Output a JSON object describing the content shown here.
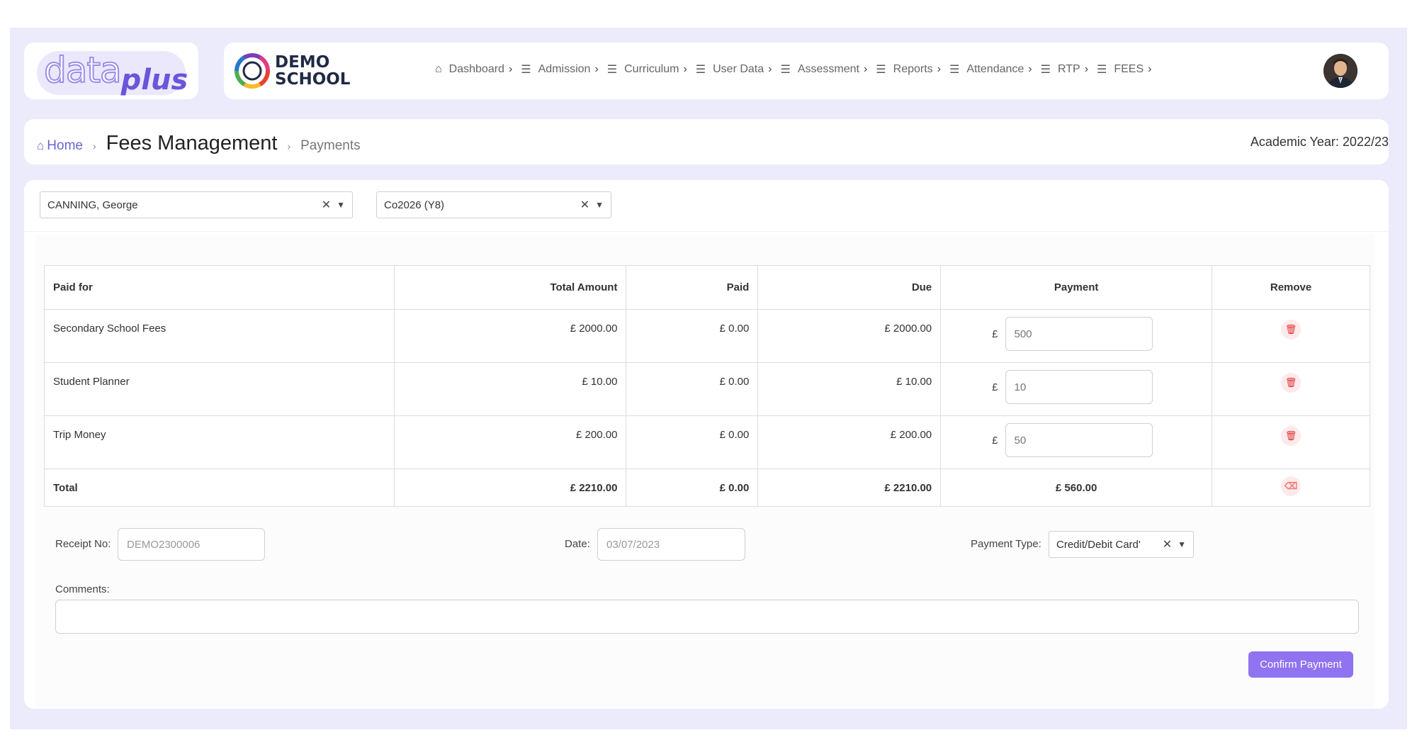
{
  "app": {
    "logo": {
      "part1": "data",
      "part2": "plus"
    },
    "school": {
      "line1": "DEMO",
      "line2": "SCHOOL"
    }
  },
  "nav": {
    "items": [
      {
        "label": "Dashboard",
        "icon": "home-icon"
      },
      {
        "label": "Admission",
        "icon": "menu-icon"
      },
      {
        "label": "Curriculum",
        "icon": "menu-icon"
      },
      {
        "label": "User Data",
        "icon": "menu-icon"
      },
      {
        "label": "Assessment",
        "icon": "menu-icon"
      },
      {
        "label": "Reports",
        "icon": "menu-icon"
      },
      {
        "label": "Attendance",
        "icon": "menu-icon"
      },
      {
        "label": "RTP",
        "icon": "menu-icon"
      },
      {
        "label": "FEES",
        "icon": "menu-icon"
      }
    ]
  },
  "breadcrumb": {
    "home": "Home",
    "title": "Fees Management",
    "sub": "Payments"
  },
  "academic_year": "Academic Year: 2022/23",
  "filters": {
    "student": "CANNING, George",
    "class": "Co2026 (Y8)"
  },
  "table": {
    "headers": {
      "paid_for": "Paid for",
      "total": "Total Amount",
      "paid": "Paid",
      "due": "Due",
      "payment": "Payment",
      "remove": "Remove"
    },
    "currency": "£",
    "rows": [
      {
        "name": "Secondary School Fees",
        "total": "£ 2000.00",
        "paid": "£ 0.00",
        "due": "£ 2000.00",
        "payment": "500"
      },
      {
        "name": "Student Planner",
        "total": "£ 10.00",
        "paid": "£ 0.00",
        "due": "£ 10.00",
        "payment": "10"
      },
      {
        "name": "Trip Money",
        "total": "£ 200.00",
        "paid": "£ 0.00",
        "due": "£ 200.00",
        "payment": "50"
      }
    ],
    "total_row": {
      "label": "Total",
      "total": "£ 2210.00",
      "paid": "£ 0.00",
      "due": "£ 2210.00",
      "payment": "£ 560.00"
    }
  },
  "form": {
    "receipt_label": "Receipt No:",
    "receipt_value": "DEMO2300006",
    "date_label": "Date:",
    "date_value": "03/07/2023",
    "payment_type_label": "Payment Type:",
    "payment_type_value": "Credit/Debit Card'",
    "comments_label": "Comments:",
    "confirm_label": "Confirm Payment"
  },
  "colors": {
    "accent": "#8f73f0",
    "background": "#ecebfb",
    "danger": "#e03030"
  }
}
